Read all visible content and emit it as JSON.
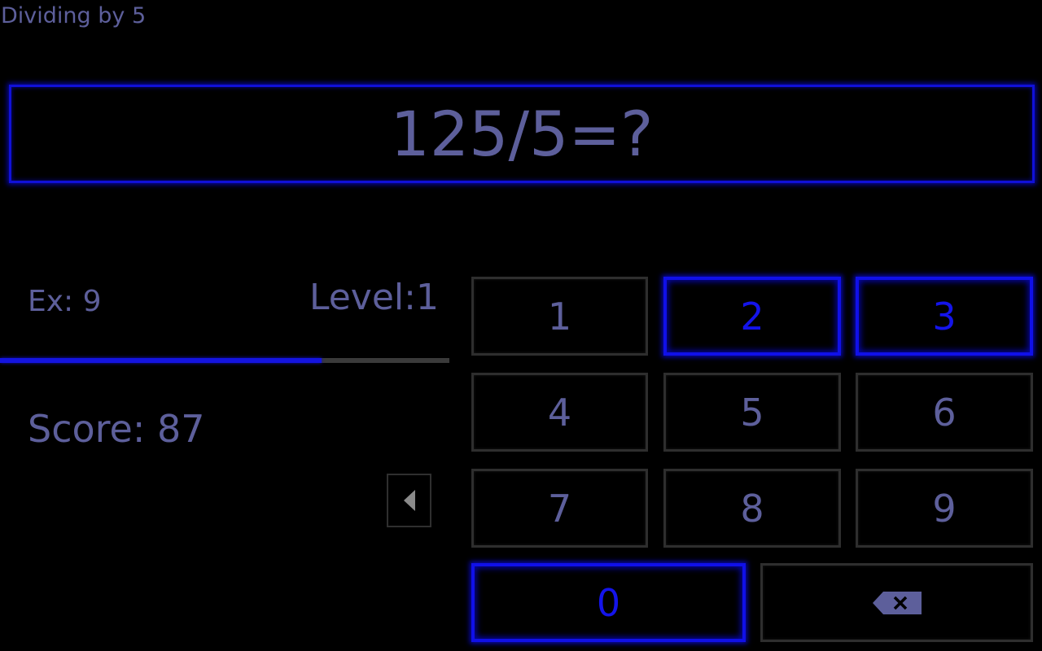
{
  "app": {
    "title": "Dividing by 5"
  },
  "question": {
    "text": "125/5=?"
  },
  "stats": {
    "exercise_label": "Ex: 9",
    "level_label": "Level:1",
    "score_label": "Score: 87",
    "progress_fraction": 0.715
  },
  "keypad": {
    "keys": [
      "1",
      "2",
      "3",
      "4",
      "5",
      "6",
      "7",
      "8",
      "9",
      "0"
    ],
    "highlighted": [
      "2",
      "3",
      "0"
    ]
  },
  "icons": {
    "previous": "triangle-left-icon",
    "backspace": "backspace-icon"
  },
  "colors": {
    "background": "#000000",
    "text": "#5d5f9b",
    "accent": "#1010e8",
    "key_border": "#2e2e2e"
  }
}
